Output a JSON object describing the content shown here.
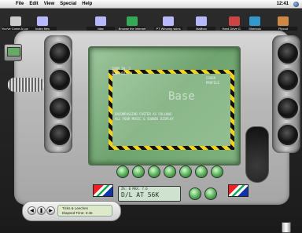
{
  "menubar": {
    "items": [
      "File",
      "Edit",
      "View",
      "Special",
      "Help"
    ],
    "clock": "12:41"
  },
  "desktop_icons": [
    {
      "label": "You've Come A Long Way, Ba...",
      "icon": "document-icon",
      "color": "#cccccc"
    },
    {
      "label": "Index files",
      "icon": "folder-icon",
      "color": "#b8b8ff"
    },
    {
      "label": "Mac",
      "icon": "folder-icon",
      "color": "#b8b8ff"
    },
    {
      "label": "Browse the Internet",
      "icon": "globe-icon",
      "color": "#33aa55"
    },
    {
      "label": "PT Winamp skins",
      "icon": "folder-icon",
      "color": "#b8b8ff"
    },
    {
      "label": "Mailbox",
      "icon": "folder-icon",
      "color": "#b8b8ff"
    },
    {
      "label": "Hard Drive Ghoul",
      "icon": "drive-icon",
      "color": "#cc4444"
    },
    {
      "label": "Sherlock",
      "icon": "globe-icon",
      "color": "#3399cc"
    },
    {
      "label": "Flipout",
      "icon": "drive-icon",
      "color": "#cc8844"
    }
  ],
  "skin": {
    "screen_line1": "ZOOM IN: 2",
    "screen_line2": "ZOOM OUT: 1",
    "screen_right1": "COVER",
    "screen_right2": "PROFILE",
    "screen_caption": "ENCOMPASSING FASTER AS FOLLOWS",
    "screen_caption2": "ALL YOUR MUSIC & SOUNDS DISPLAY",
    "logo": "Base",
    "lcd_small": "ZA: 0  MAX: 7.6",
    "lcd_main": "D/L AT 56K"
  },
  "player": {
    "line1": "Ticks & Leeches",
    "line2": "Elapsed Time: 3:45"
  }
}
